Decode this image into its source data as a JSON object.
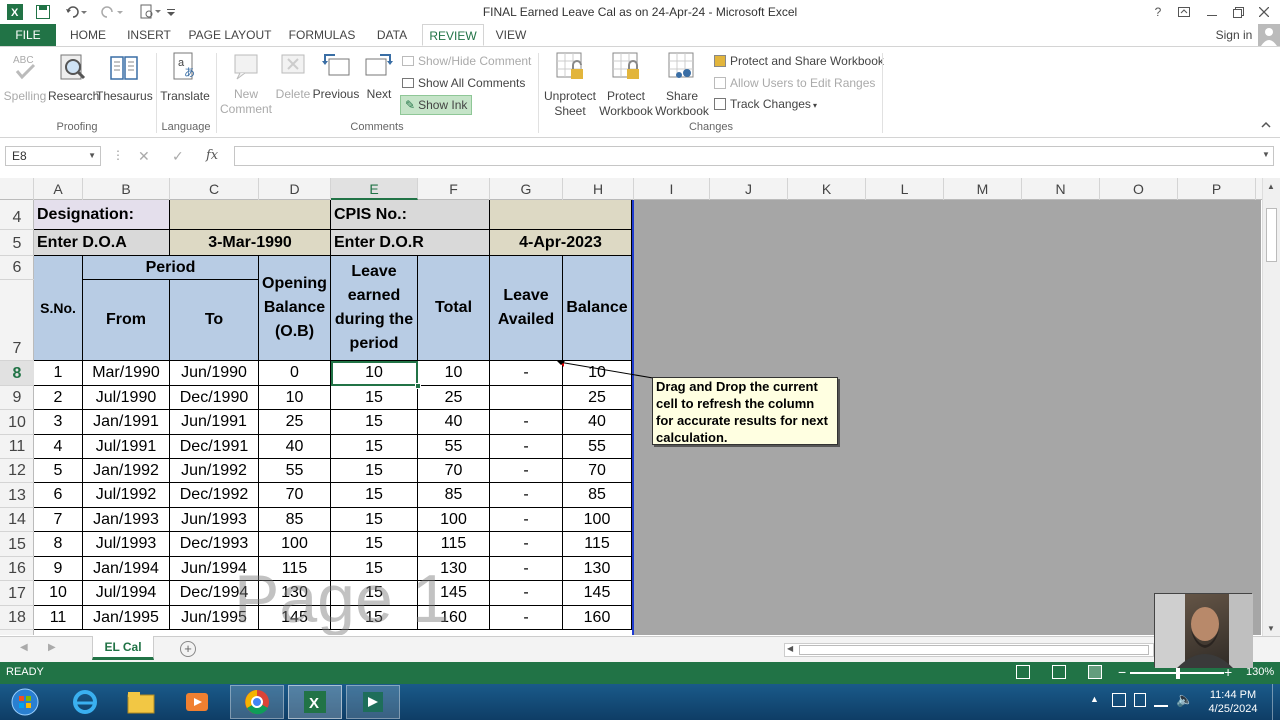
{
  "window": {
    "title": "FINAL Earned Leave Cal as on 24-Apr-24 - Microsoft Excel",
    "help": "?",
    "sign_in": "Sign in"
  },
  "tabs": [
    "FILE",
    "HOME",
    "INSERT",
    "PAGE LAYOUT",
    "FORMULAS",
    "DATA",
    "REVIEW",
    "VIEW"
  ],
  "ribbon": {
    "proofing": {
      "spelling": "Spelling",
      "research": "Research",
      "thesaurus": "Thesaurus",
      "group": "Proofing"
    },
    "language": {
      "translate": "Translate",
      "group": "Language"
    },
    "comments": {
      "new1": "New",
      "new2": "Comment",
      "delete": "Delete",
      "previous": "Previous",
      "next": "Next",
      "show_hide": "Show/Hide Comment",
      "show_all": "Show All Comments",
      "show_ink": "Show Ink",
      "group": "Comments"
    },
    "changes": {
      "unprotect1": "Unprotect",
      "unprotect2": "Sheet",
      "protect1": "Protect",
      "protect2": "Workbook",
      "share1": "Share",
      "share2": "Workbook",
      "protect_share": "Protect and Share Workbook",
      "allow_users": "Allow Users to Edit Ranges",
      "track_changes": "Track Changes",
      "group": "Changes"
    }
  },
  "formula_bar": {
    "name_box": "E8",
    "fx": "fx",
    "value": ""
  },
  "columns": [
    "A",
    "B",
    "C",
    "D",
    "E",
    "F",
    "G",
    "H",
    "I",
    "J",
    "K",
    "L",
    "M",
    "N",
    "O",
    "P"
  ],
  "rows": [
    "4",
    "5",
    "6",
    "7",
    "8",
    "9",
    "10",
    "11",
    "12",
    "13",
    "14",
    "15",
    "16",
    "17",
    "18"
  ],
  "sheet": {
    "designation_label": "Designation:",
    "cpis_label": "CPIS No.:",
    "doa_label": "Enter D.O.A",
    "doa_value": "3-Mar-1990",
    "dor_label": "Enter D.O.R",
    "dor_value": "4-Apr-2023",
    "headers": {
      "sno": "S.No.",
      "period": "Period",
      "from": "From",
      "to": "To",
      "ob": "Opening Balance (O.B)",
      "earned": "Leave earned during the period",
      "total": "Total",
      "availed": "Leave Availed",
      "balance": "Balance"
    },
    "data": [
      [
        "1",
        "Mar/1990",
        "Jun/1990",
        "0",
        "10",
        "10",
        "-",
        "10"
      ],
      [
        "2",
        "Jul/1990",
        "Dec/1990",
        "10",
        "15",
        "25",
        "",
        "25"
      ],
      [
        "3",
        "Jan/1991",
        "Jun/1991",
        "25",
        "15",
        "40",
        "-",
        "40"
      ],
      [
        "4",
        "Jul/1991",
        "Dec/1991",
        "40",
        "15",
        "55",
        "-",
        "55"
      ],
      [
        "5",
        "Jan/1992",
        "Jun/1992",
        "55",
        "15",
        "70",
        "-",
        "70"
      ],
      [
        "6",
        "Jul/1992",
        "Dec/1992",
        "70",
        "15",
        "85",
        "-",
        "85"
      ],
      [
        "7",
        "Jan/1993",
        "Jun/1993",
        "85",
        "15",
        "100",
        "-",
        "100"
      ],
      [
        "8",
        "Jul/1993",
        "Dec/1993",
        "100",
        "15",
        "115",
        "-",
        "115"
      ],
      [
        "9",
        "Jan/1994",
        "Jun/1994",
        "115",
        "15",
        "130",
        "-",
        "130"
      ],
      [
        "10",
        "Jul/1994",
        "Dec/1994",
        "130",
        "15",
        "145",
        "-",
        "145"
      ],
      [
        "11",
        "Jan/1995",
        "Jun/1995",
        "145",
        "15",
        "160",
        "-",
        "160"
      ]
    ]
  },
  "comment": "Drag and Drop the current cell to refresh the column for accurate results for next calculation.",
  "watermark": "Page 1",
  "sheet_tab": "EL Cal",
  "status": {
    "ready": "READY",
    "zoom": "130%"
  },
  "clock": {
    "time": "11:44 PM",
    "date": "4/25/2024"
  },
  "colors": {
    "excel_green": "#217346",
    "header_blue": "#b8cce4"
  }
}
